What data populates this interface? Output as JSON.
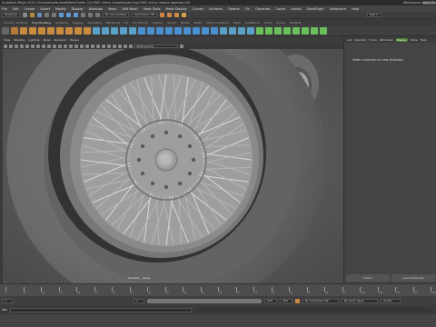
{
  "titlebar": {
    "title": "Autodesk Maya 2020: D:\\asset\\web asset\\New folder (2)\\1962 chevy impala\\open top\\1962 chevy impala opentop.mb",
    "workspace_label": "Workspace:",
    "workspace_value": "Maya Classic"
  },
  "menus": [
    "File",
    "Edit",
    "Create",
    "Select",
    "Modify",
    "Display",
    "Windows",
    "Mesh",
    "Edit Mesh",
    "Mesh Tools",
    "Mesh Display",
    "Curves",
    "Surfaces",
    "Deform",
    "UV",
    "Generate",
    "Cache",
    "Arnold",
    "OpenFlight",
    "Substance",
    "Help"
  ],
  "statusline": {
    "mode": "Modeling",
    "live_surface": "No Live Surface",
    "symmetry": "Symmetry: Off",
    "sign_in": "Sign In"
  },
  "shelf_tabs": [
    "Curves / Surfaces",
    "Poly Modeling",
    "Sculpting",
    "Rigging",
    "Animation",
    "Rendering",
    "FX",
    "FX Caching",
    "Custom",
    "Arnold",
    "Bifrost",
    "MASH",
    "Motion Graphics",
    "XGen",
    "Substance",
    "Fluids",
    "Arnold",
    "Redshift"
  ],
  "panel_menu": [
    "View",
    "Shading",
    "Lighting",
    "Show",
    "Renderer",
    "Panels"
  ],
  "viewport": {
    "camera_field": "sRGB gamma",
    "camera_label": "Invisible _ persp",
    "colors": {
      "bg": "#5e5e5e",
      "tire": "#6a6a6a",
      "rim": "#8a8a8a",
      "spoke": "#bdbdbd"
    }
  },
  "attribute_editor": {
    "tabs": [
      "List",
      "Selected",
      "Focus",
      "Attributes",
      "Display",
      "Show",
      "Help"
    ],
    "active_tab": "Display",
    "message": "Make a selection to view attributes",
    "buttons": [
      "Select",
      "Load Attributes"
    ]
  },
  "timeline": {
    "ticks": [
      "1",
      "5",
      "10",
      "15",
      "20",
      "25",
      "30",
      "35",
      "40",
      "45",
      "50",
      "55",
      "60",
      "65",
      "70",
      "75",
      "80",
      "85",
      "90",
      "95",
      "100",
      "105",
      "110",
      "115",
      "120"
    ]
  },
  "range": {
    "start": "1",
    "inner_start": "1",
    "inner_end": "120",
    "end": "120",
    "end2": "200",
    "char_set": "No Character Set",
    "anim_layer": "No Anim Layer",
    "fps": "24 fps"
  },
  "cmdline": {
    "label": "MEL"
  }
}
